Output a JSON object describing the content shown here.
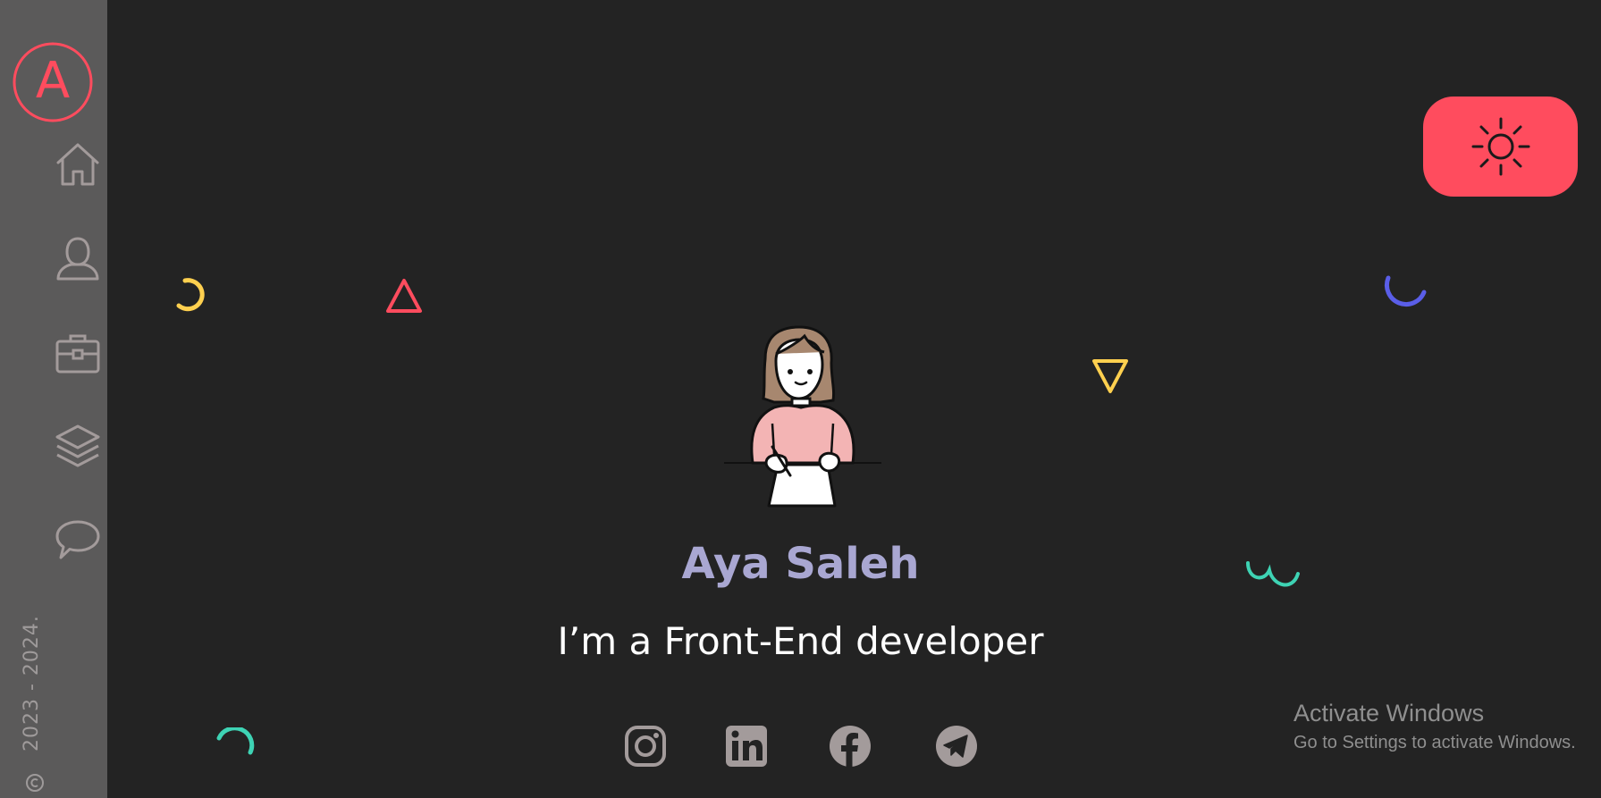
{
  "profile": {
    "name": "Aya Saleh",
    "tagline": "I’m a Front-End developer"
  },
  "logo": {
    "letter": "A"
  },
  "sidebar": {
    "items": [
      {
        "icon": "home-icon"
      },
      {
        "icon": "user-icon"
      },
      {
        "icon": "briefcase-icon"
      },
      {
        "icon": "layers-icon"
      },
      {
        "icon": "chat-icon"
      }
    ]
  },
  "footer": {
    "copyright_years": "2023 - 2024."
  },
  "social": [
    {
      "icon": "instagram-icon"
    },
    {
      "icon": "linkedin-icon"
    },
    {
      "icon": "facebook-icon"
    },
    {
      "icon": "telegram-icon"
    }
  ],
  "theme_toggle": {
    "icon": "sun-icon"
  },
  "watermark": {
    "title": "Activate Windows",
    "subtitle": "Go to Settings to activate Windows."
  },
  "colors": {
    "background": "#232323",
    "sidebar": "#5b5a5a",
    "accent": "#ff4c5e",
    "name": "#a9a7d2",
    "icon": "#a39b9b",
    "yellow": "#ffd04f",
    "blue": "#5a5ee8",
    "green": "#3ed3b4"
  }
}
